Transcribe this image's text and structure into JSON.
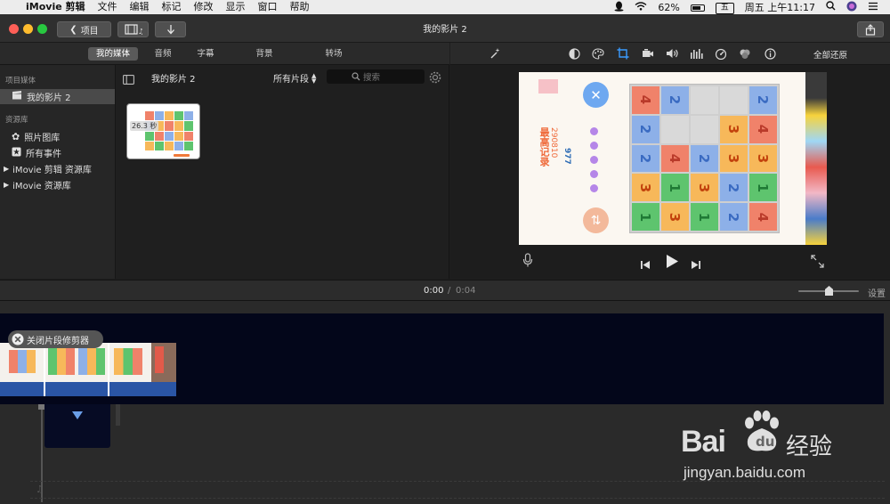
{
  "menubar": {
    "app_name": "iMovie 剪辑",
    "items": [
      "文件",
      "编辑",
      "标记",
      "修改",
      "显示",
      "窗口",
      "帮助"
    ],
    "battery": "62%",
    "input_method": "五",
    "clock": "周五 上午11:17"
  },
  "toolbar": {
    "back_label": "项目",
    "title": "我的影片 2"
  },
  "browser_tabs": [
    "我的媒体",
    "音频",
    "字幕",
    "背景",
    "转场"
  ],
  "viewer_tools": {
    "reset_label": "全部还原",
    "icons": [
      "magic-wand-icon",
      "color-balance-icon",
      "color-palette-icon",
      "crop-icon",
      "stabilize-icon",
      "volume-icon",
      "equalizer-icon",
      "speed-icon",
      "filter-icon",
      "info-icon"
    ]
  },
  "sidebar": {
    "section1": "项目媒体",
    "project_item": "我的影片 2",
    "section2": "资源库",
    "items": [
      "照片图库",
      "所有事件",
      "iMovie 剪辑 资源库",
      "iMovie 资源库"
    ]
  },
  "browser": {
    "title": "我的影片 2",
    "filter": "所有片段",
    "search_placeholder": "搜索",
    "clip_duration": "26.3 秒"
  },
  "viewer": {
    "game": {
      "best_label": "最高记录",
      "best_score": "290810",
      "score": "977",
      "grid": [
        [
          "4",
          "2",
          "",
          "",
          "2"
        ],
        [
          "2",
          "",
          "",
          "3",
          "4"
        ],
        [
          "2",
          "4",
          "2",
          "3",
          "3"
        ],
        [
          "3",
          "1",
          "3",
          "2",
          "1"
        ],
        [
          "1",
          "3",
          "1",
          "2",
          "4"
        ]
      ],
      "colors": {
        "1": "#5ec46e",
        "2": "#8db0e8",
        "3": "#f7b85a",
        "4": "#f0826a",
        "empty": "#d9d9d9"
      }
    }
  },
  "timebar": {
    "current": "0:00",
    "separator": "/",
    "total": "0:04",
    "settings_label": "设置"
  },
  "timeline": {
    "close_trimmer_label": "关闭片段修剪器"
  },
  "watermark": {
    "brand": "Bai",
    "brand_cn": "经验",
    "url": "jingyan.baidu.com"
  },
  "colors": {
    "accent": "#0a84ff",
    "timeline_clip": "#2a55a5",
    "track_bg": "#03061a"
  }
}
